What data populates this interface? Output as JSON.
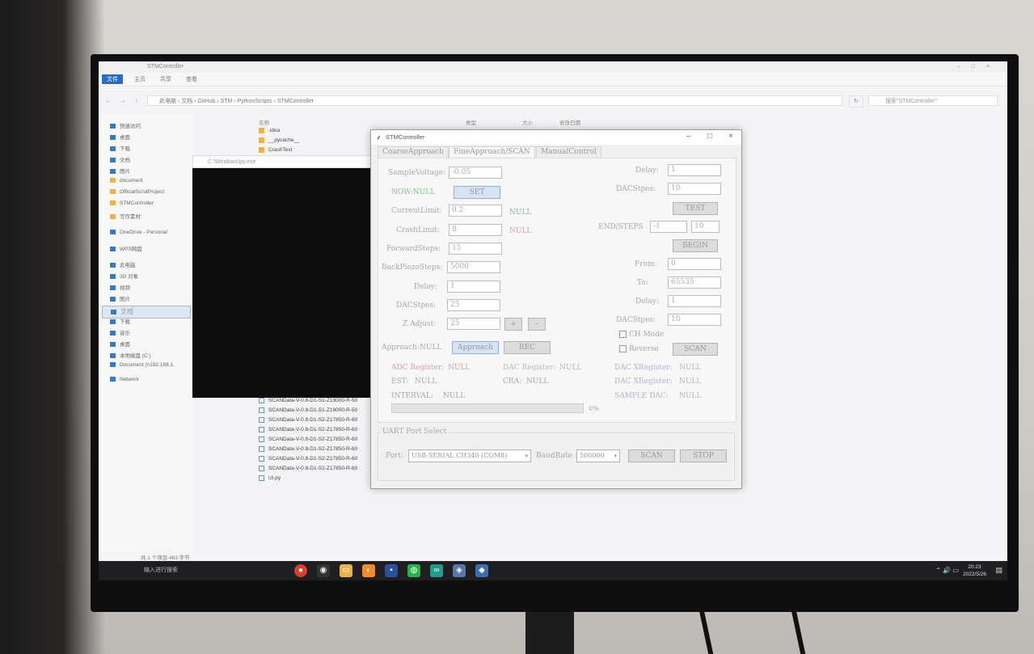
{
  "explorer": {
    "title": "STMController",
    "ribbon": [
      "文件",
      "主页",
      "共享",
      "查看"
    ],
    "nav_buttons": "← → ↑",
    "path": "此电脑 › 文档 › GitHub › STM › PythonScripts › STMController",
    "search_placeholder": "搜索\"STMController\"",
    "columns": {
      "name": "名称",
      "type": "类型",
      "size": "大小",
      "modified": "修改日期"
    },
    "nav_items": [
      "快速访问",
      "桌面",
      "下载",
      "文档",
      "图片",
      "document",
      "OfficialScrutProject",
      "STMController",
      "写作素材",
      "OneDrive - Personal",
      "WPS网盘",
      "此电脑",
      "3D 对象",
      "视频",
      "图片",
      "文档",
      "下载",
      "音乐",
      "桌面",
      "本地磁盘 (C:)",
      "Document (\\\\192.168.1.",
      "Network"
    ],
    "folders": [
      ".idea",
      "__pycache__",
      "CrashTest"
    ],
    "files": [
      "SCANData-V-0.8-D1-S1-Z19000-R-50",
      "SCANData-V-0.8-D1-S1-Z19000-R-50",
      "SCANData-V-0.8-D1-S2-Z17850-R-60",
      "SCANData-V-0.8-D1-S2-Z17850-R-60",
      "SCANData-V-0.8-D1-S2-Z17850-R-60",
      "SCANData-V-0.8-D1-S2-Z17850-R-60",
      "SCANData-V-0.8-D1-S2-Z17850-R-60",
      "SCANData-V-0.8-D1-S2-Z17850-R-60",
      "UI.py"
    ],
    "status": "共 1 个项目   463 字节"
  },
  "terminal": {
    "title": "C:\\Windows\\py.exe"
  },
  "stm": {
    "title": "STMController",
    "window_controls": {
      "min": "–",
      "max": "□",
      "close": "×"
    },
    "tabs": [
      "CoarseApproach",
      "FineApproach/SCAN",
      "ManualControl"
    ],
    "left": {
      "sample_voltage_label": "SampleVoltage:",
      "sample_voltage": "-0.05",
      "now_label": "NOW:NULL",
      "set": "SET",
      "current_limit_label": "CurrentLimit:",
      "current_limit": "0.2",
      "current_status": "NULL",
      "crash_limit_label": "CrashLimit:",
      "crash_limit": "8",
      "crash_status": "NULL",
      "forward_label": "ForwardSteps:",
      "forward": "15",
      "back_label": "BackPiezoSteps:",
      "back": "5000",
      "delay_label": "Delay:",
      "delay": "1",
      "dacstpes_label": "DACStpes:",
      "dacstpes": "25",
      "zadjust_label": "Z Adjust:",
      "zadjust": "25",
      "plus": "+",
      "minus": "–",
      "approach_status": "Approach:NULL",
      "approach_btn": "Approach",
      "rec": "REC"
    },
    "right": {
      "delay_label": "Delay:",
      "delay": "1",
      "dacstpes_label": "DACStpes:",
      "dacstpes": "10",
      "test": "TEST",
      "endsteps_label": "END/STEPS",
      "end": "-1",
      "steps": "10",
      "begin": "BEGIN",
      "from_label": "From:",
      "from": "0",
      "to_label": "To:",
      "to": "65535",
      "delay2_label": "Delay:",
      "delay2": "1",
      "dacstpes2_label": "DACStpes:",
      "dacstpes2": "10",
      "ch_mode": "CH Mode",
      "reverse": "Reverse",
      "scan": "SCAN"
    },
    "status": {
      "adc_label": "ADC Register:",
      "adc": "NULL",
      "dac_label": "DAC Register:",
      "dac": "NULL",
      "dacx_label": "DAC XRegister:",
      "dacx": "NULL",
      "est_label": "EST:",
      "est": "NULL",
      "cra_label": "CRA:",
      "cra": "NULL",
      "dacx2_label": "DAC XRegister:",
      "dacx2": "NULL",
      "interval_label": "INTERVAL:",
      "interval": "NULL",
      "sample_dac_label": "SAMPLE DAC:",
      "sample_dac": "NULL",
      "progress": 0,
      "progress_text": "0%"
    },
    "uart": {
      "title": "UART Port Select",
      "port_label": "Port:",
      "port": "USB-SERIAL CH340 (COM8)",
      "baud_label": "BaudRate :",
      "baud": "500000",
      "scan": "SCAN",
      "stop": "STOP"
    }
  },
  "taskbar": {
    "search": "输入进行搜索",
    "time": "20:23",
    "date": "2022/5/26",
    "tray": "⌃ 🔊 ▭"
  },
  "colors": {
    "progress_fill": "#44a04a",
    "label_green": "#8ac08a",
    "label_red": "#d9a0a0",
    "label_purple": "#b4b2d2"
  }
}
